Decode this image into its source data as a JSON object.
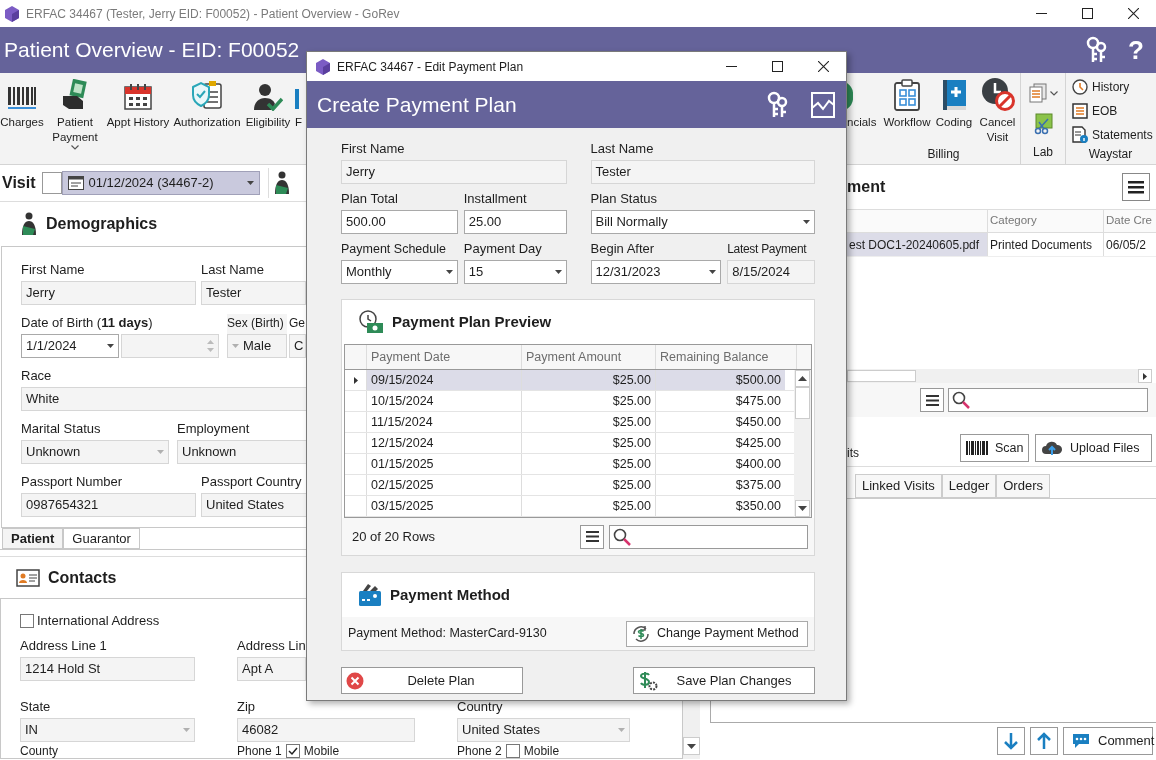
{
  "window": {
    "title": "ERFAC 34467 (Tester, Jerry EID: F00052) - Patient Overview - GoRev"
  },
  "header": {
    "title": "Patient Overview - EID: F00052",
    "help": "?"
  },
  "ribbon": {
    "left": [
      {
        "label": "Charges",
        "dropdown": false
      },
      {
        "label": "Patient Payment",
        "dropdown": true
      },
      {
        "label": "Appt History",
        "dropdown": false
      },
      {
        "label": "Authorization",
        "dropdown": false
      },
      {
        "label": "Eligibility",
        "dropdown": false
      },
      {
        "label": "F",
        "dropdown": false
      }
    ],
    "billing": {
      "label": "Billing",
      "buttons": [
        {
          "label": "ncials"
        },
        {
          "label": "Workflow"
        },
        {
          "label": "Coding"
        },
        {
          "label": "Cancel Visit"
        }
      ]
    },
    "lab": {
      "label": "Lab"
    },
    "waystar": {
      "label": "Waystar",
      "items": [
        "History",
        "EOB",
        "Statements"
      ]
    }
  },
  "visit": {
    "label": "Visit",
    "checked": false,
    "value": "01/12/2024 (34467-2)"
  },
  "demographics": {
    "title": "Demographics",
    "first_name": {
      "label": "First Name",
      "value": "Jerry",
      "kind": "readonly"
    },
    "last_name": {
      "label": "Last Name",
      "value": "Tester",
      "kind": "readonly"
    },
    "date_of_birth": {
      "label": "Date of Birth (**11 days**)",
      "value": "1/1/2024",
      "kind": "date"
    },
    "sex": {
      "label": "Sex (Birth)",
      "value": "Male",
      "kind": "dropdown_disabled"
    },
    "cut_field": {
      "label": "Ge",
      "value": "C",
      "kind": "readonly"
    },
    "race": {
      "label": "Race",
      "value": "White",
      "kind": "readonly"
    },
    "marital_status": {
      "label": "Marital Status",
      "value": "Unknown",
      "kind": "dropdown_disabled"
    },
    "employment": {
      "label": "Employment",
      "value": "Unknown",
      "kind": "readonly"
    },
    "passport_number": {
      "label": "Passport Number",
      "value": "0987654321",
      "kind": "readonly"
    },
    "passport_country": {
      "label": "Passport Country",
      "value": "United States",
      "kind": "readonly"
    }
  },
  "patient_tabs": [
    {
      "label": "Patient",
      "selected": true
    },
    {
      "label": "Guarantor",
      "selected": false
    }
  ],
  "contacts": {
    "title": "Contacts",
    "international_address": {
      "label": "International Address",
      "checked": false
    },
    "address_line_1": {
      "label": "Address Line 1",
      "value": "1214 Hold St",
      "kind": "readonly"
    },
    "address_line_2": {
      "label": "Address Lin",
      "value": "Apt A",
      "kind": "readonly"
    },
    "state": {
      "label": "State",
      "value": "IN",
      "kind": "dropdown_disabled"
    },
    "zip": {
      "label": "Zip",
      "value": "46082",
      "kind": "readonly"
    },
    "country": {
      "label": "Country",
      "value": "United States",
      "kind": "dropdown_disabled"
    },
    "county": {
      "label": "County"
    },
    "phones": [
      {
        "label": "Phone 1",
        "mobile_label": "Mobile",
        "checked": true
      },
      {
        "label": "Phone 2",
        "mobile_label": "Mobile",
        "checked": false
      }
    ]
  },
  "documents": {
    "title": "ment",
    "columns": [
      "",
      "Category",
      "Date Cre"
    ],
    "rows": [
      {
        "cells": [
          "est DOC1-20240605.pdf",
          "Printed Documents",
          "06/05/2"
        ],
        "selected": true
      }
    ],
    "label_cut": "its",
    "scan": "Scan",
    "upload": "Upload Files",
    "tabs": [
      {
        "label": "Linked Visits",
        "selected": false
      },
      {
        "label": "Ledger",
        "selected": false
      },
      {
        "label": "Orders",
        "selected": false
      }
    ]
  },
  "bottom_bar": {
    "comment": "Comment"
  },
  "dialog": {
    "title": "ERFAC 34467 - Edit Payment Plan",
    "heading": "Create Payment Plan",
    "first_name": {
      "label": "First Name",
      "value": "Jerry",
      "kind": "readonly"
    },
    "last_name": {
      "label": "Last Name",
      "value": "Tester",
      "kind": "readonly"
    },
    "plan_total": {
      "label": "Plan Total",
      "value": "500.00",
      "kind": "text"
    },
    "installment": {
      "label": "Installment",
      "value": "25.00",
      "kind": "text"
    },
    "plan_status": {
      "label": "Plan Status",
      "value": "Bill Normally",
      "kind": "dropdown"
    },
    "payment_schedule": {
      "label": "Payment Schedule",
      "value": "Monthly",
      "kind": "dropdown"
    },
    "payment_day": {
      "label": "Payment Day",
      "value": "15",
      "kind": "dropdown"
    },
    "begin_after": {
      "label": "Begin After",
      "value": "12/31/2023",
      "kind": "date"
    },
    "latest_payment": {
      "label": "Latest Payment",
      "value": "8/15/2024",
      "kind": "readonly"
    },
    "preview": {
      "title": "Payment Plan Preview",
      "columns": [
        "Payment Date",
        "Payment Amount",
        "Remaining Balance"
      ],
      "rows": [
        {
          "date": "09/15/2024",
          "amount": "$25.00",
          "balance": "$500.00",
          "selected": true
        },
        {
          "date": "10/15/2024",
          "amount": "$25.00",
          "balance": "$475.00",
          "selected": false
        },
        {
          "date": "11/15/2024",
          "amount": "$25.00",
          "balance": "$450.00",
          "selected": false
        },
        {
          "date": "12/15/2024",
          "amount": "$25.00",
          "balance": "$425.00",
          "selected": false
        },
        {
          "date": "01/15/2025",
          "amount": "$25.00",
          "balance": "$400.00",
          "selected": false
        },
        {
          "date": "02/15/2025",
          "amount": "$25.00",
          "balance": "$375.00",
          "selected": false
        },
        {
          "date": "03/15/2025",
          "amount": "$25.00",
          "balance": "$350.00",
          "selected": false
        }
      ],
      "row_count": "20 of 20 Rows"
    },
    "payment_method": {
      "title": "Payment Method",
      "text": "Payment Method: MasterCard-9130",
      "change": "Change Payment Method"
    },
    "delete": "Delete Plan",
    "save": "Save Plan Changes"
  }
}
